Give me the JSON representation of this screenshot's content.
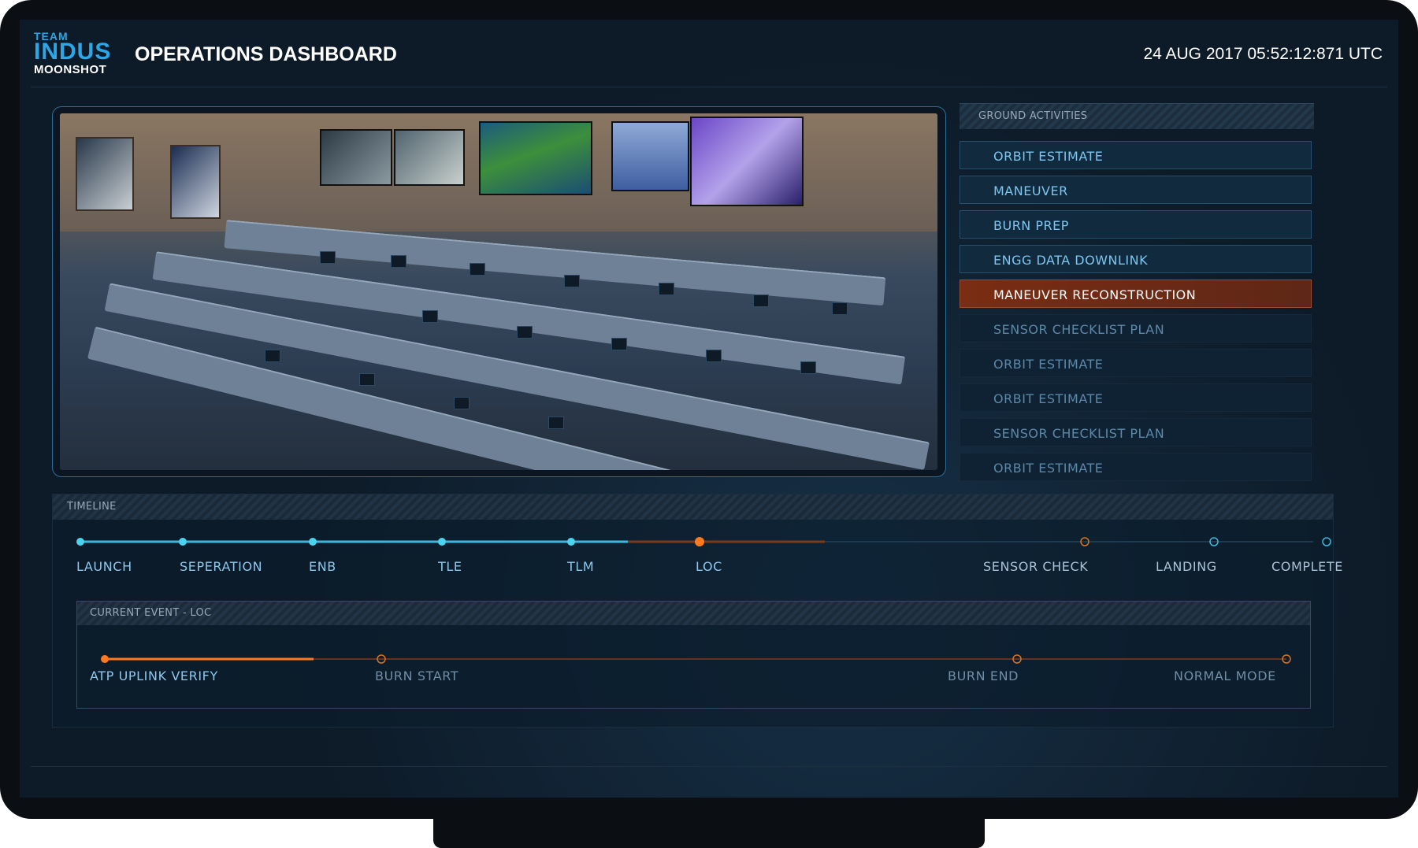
{
  "header": {
    "logo": {
      "line1": "TEAM",
      "line2": "INDUS",
      "line3": "MOONSHOT"
    },
    "title": "OPERATIONS DASHBOARD",
    "datetime": "24 AUG 2017 05:52:12:871 UTC"
  },
  "ground_activities": {
    "title": "GROUND ACTIVITIES",
    "items": [
      {
        "label": "ORBIT ESTIMATE",
        "state": "done"
      },
      {
        "label": "MANEUVER",
        "state": "done"
      },
      {
        "label": "BURN PREP",
        "state": "done"
      },
      {
        "label": "ENGG DATA DOWNLINK",
        "state": "done"
      },
      {
        "label": "MANEUVER RECONSTRUCTION",
        "state": "active"
      },
      {
        "label": "SENSOR CHECKLIST PLAN",
        "state": "pending"
      },
      {
        "label": "ORBIT ESTIMATE",
        "state": "pending"
      },
      {
        "label": "ORBIT ESTIMATE",
        "state": "pending"
      },
      {
        "label": "SENSOR CHECKLIST PLAN",
        "state": "pending"
      },
      {
        "label": "ORBIT ESTIMATE",
        "state": "pending"
      }
    ]
  },
  "timeline": {
    "title": "TIMELINE",
    "milestones": [
      {
        "label": "LAUNCH",
        "state": "done"
      },
      {
        "label": "SEPERATION",
        "state": "done"
      },
      {
        "label": "ENB",
        "state": "done"
      },
      {
        "label": "TLE",
        "state": "done"
      },
      {
        "label": "TLM",
        "state": "done"
      },
      {
        "label": "LOC",
        "state": "current"
      },
      {
        "label": "SENSOR CHECK",
        "state": "pending"
      },
      {
        "label": "LANDING",
        "state": "pending"
      },
      {
        "label": "COMPLETE",
        "state": "pending"
      }
    ]
  },
  "current_event": {
    "title": "CURRENT EVENT - LOC",
    "steps": [
      {
        "label": "ATP UPLINK VERIFY",
        "state": "current"
      },
      {
        "label": "BURN START",
        "state": "pending"
      },
      {
        "label": "BURN END",
        "state": "pending"
      },
      {
        "label": "NORMAL MODE",
        "state": "pending"
      }
    ]
  },
  "colors": {
    "accent_blue": "#2aa7e6",
    "done_cyan": "#49d3ee",
    "current_orange": "#ff7a1f",
    "active_row": "#7a2d12"
  }
}
